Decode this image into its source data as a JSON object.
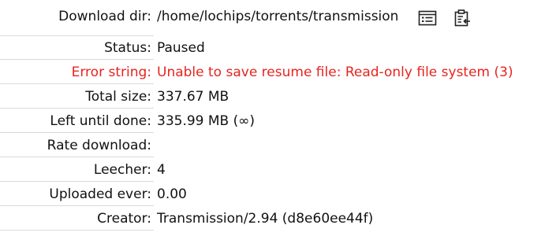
{
  "fields": [
    {
      "key": "download_dir",
      "label": "Download dir:",
      "value": "/home/lochips/torrents/transmission"
    },
    {
      "key": "status",
      "label": "Status:",
      "value": "Paused"
    },
    {
      "key": "error_string",
      "label": "Error string:",
      "value": "Unable to save resume file: Read-only file system (3)"
    },
    {
      "key": "total_size",
      "label": "Total size:",
      "value": "337.67 MB"
    },
    {
      "key": "left_until_done",
      "label": "Left until done:",
      "value": "335.99 MB (∞)"
    },
    {
      "key": "rate_download",
      "label": "Rate download:",
      "value": ""
    },
    {
      "key": "leecher",
      "label": "Leecher:",
      "value": "4"
    },
    {
      "key": "uploaded_ever",
      "label": "Uploaded ever:",
      "value": "0.00"
    },
    {
      "key": "creator",
      "label": "Creator:",
      "value": "Transmission/2.94 (d8e60ee44f)"
    }
  ],
  "icons": {
    "open_folder": "folder-list-icon",
    "copy_path": "clipboard-copy-icon"
  },
  "colors": {
    "error": "#e8231f",
    "divider": "#dadada",
    "text": "#111111"
  }
}
